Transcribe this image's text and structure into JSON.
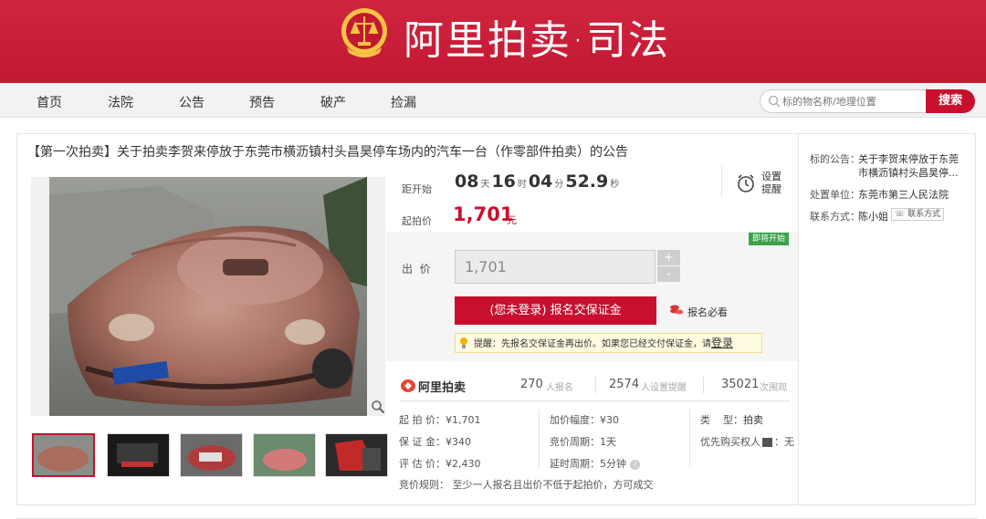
{
  "banner": {
    "brand": "阿里拍卖·司法"
  },
  "nav": {
    "items": [
      "首页",
      "法院",
      "公告",
      "预告",
      "破产",
      "捡漏"
    ],
    "search_placeholder": "标的物名称/地理位置",
    "search_button": "搜索"
  },
  "auction": {
    "title": "【第一次拍卖】关于拍卖李贺来停放于东莞市横沥镇村头昌昊停车场内的汽车一台（作零部件拍卖）的公告",
    "countdown_label": "距开始",
    "countdown": {
      "days": "08",
      "days_unit": "天",
      "hours": "16",
      "hours_unit": "时",
      "minutes": "04",
      "minutes_unit": "分",
      "seconds": "52.9",
      "seconds_unit": "秒"
    },
    "start_price_label": "起拍价",
    "start_price": "1,701",
    "start_price_unit": "元",
    "remind_label": "设置提醒",
    "badge": "即将开始",
    "bid_label": "出  价",
    "bid_value": "1,701",
    "plus": "+",
    "minus": "-",
    "register_button": "(您未登录) 报名交保证金",
    "must_read": "报名必看",
    "tip_text": "提醒：先报名交保证金再出价。如果您已经交付保证金，请",
    "tip_login": "登录"
  },
  "stats": {
    "logo_text": "阿里拍卖",
    "registered": "270",
    "registered_label": "人报名",
    "reminders": "2574",
    "reminders_label": "人设置提醒",
    "views": "35021",
    "views_label": "次围观"
  },
  "details": {
    "start_price": "起 拍 价：¥1,701",
    "deposit": "保 证 金：¥340",
    "appraisal": "评 估 价：¥2,430",
    "increment": "加价幅度：¥30",
    "cycle": "竞价周期：1天",
    "delay": "延时周期：5分钟",
    "type_label": "类    型：",
    "type_value": "拍卖",
    "priority_label": "优先购买权人",
    "priority_value": "：无",
    "rule": "竞价规则：  至少一人报名且出价不低于起拍价，方可成交"
  },
  "side": {
    "notice_label": "标的公告：",
    "notice_line1": "关于李贺来停放于东莞",
    "notice_line2": "市横沥镇村头昌昊停...",
    "unit_label": "处置单位：",
    "unit_value": "东莞市第三人民法院",
    "contact_label": "联系方式：",
    "contact_value": "陈小姐",
    "contact_button": "联系方式"
  },
  "colors": {
    "brand_red": "#c8102e",
    "banner_red": "#c9203a",
    "badge_green": "#3aa24a"
  },
  "icons": {
    "emblem": "court-emblem-icon",
    "search": "search-icon",
    "alarm": "alarm-clock-icon",
    "zoom": "zoom-icon",
    "bulb": "bulb-icon",
    "coins": "coins-icon"
  }
}
